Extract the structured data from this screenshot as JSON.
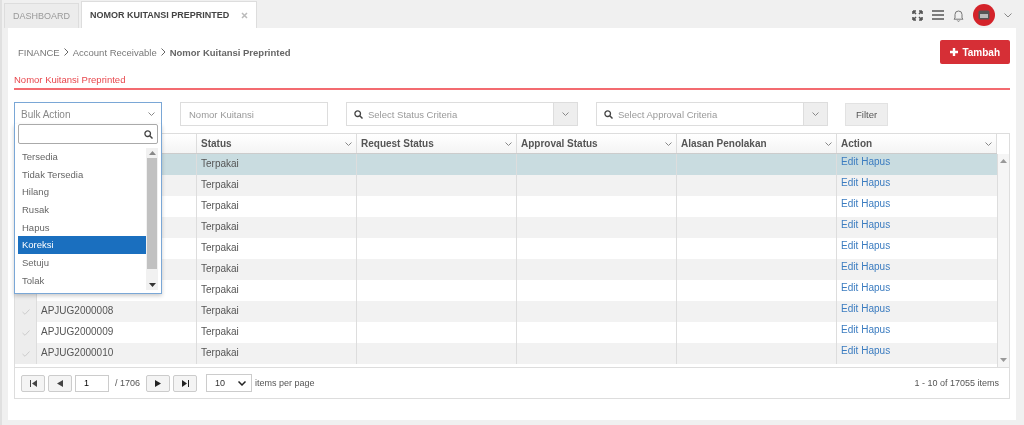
{
  "tabs": [
    {
      "label": "DASHBOARD",
      "selected": false,
      "closable": false
    },
    {
      "label": "NOMOR KUITANSI PREPRINTED",
      "selected": true,
      "closable": true
    }
  ],
  "breadcrumb": [
    "FINANCE",
    "Account Receivable",
    "Nomor Kuitansi Preprinted"
  ],
  "add_button": "Tambah",
  "section_title": "Nomor Kuitansi Preprinted",
  "filters": {
    "bulk_action": {
      "value": "Bulk Action",
      "expanded": true,
      "options": [
        {
          "label": "Tersedia",
          "selected": false
        },
        {
          "label": "Tidak Tersedia",
          "selected": false
        },
        {
          "label": "Hilang",
          "selected": false
        },
        {
          "label": "Rusak",
          "selected": false
        },
        {
          "label": "Hapus",
          "selected": false
        },
        {
          "label": "Koreksi",
          "selected": true
        },
        {
          "label": "Setuju",
          "selected": false
        },
        {
          "label": "Tolak",
          "selected": false
        }
      ]
    },
    "nomor_kuitansi": {
      "placeholder": "Nomor Kuitansi"
    },
    "status_criteria": {
      "placeholder": "Select Status Criteria"
    },
    "approval_criteria": {
      "placeholder": "Select Approval Criteria"
    },
    "filter_button": "Filter"
  },
  "table": {
    "columns": [
      "Status",
      "Request Status",
      "Approval Status",
      "Alasan Penolakan",
      "Action"
    ],
    "rows": [
      {
        "selected": true,
        "status": "Terpakai",
        "actions": [
          "Edit",
          "Hapus"
        ]
      },
      {
        "selected": false,
        "status": "Terpakai",
        "actions": [
          "Edit",
          "Hapus"
        ]
      },
      {
        "selected": false,
        "status": "Terpakai",
        "actions": [
          "Edit",
          "Hapus"
        ]
      },
      {
        "selected": false,
        "status": "Terpakai",
        "actions": [
          "Edit",
          "Hapus"
        ]
      },
      {
        "selected": false,
        "status": "Terpakai",
        "actions": [
          "Edit",
          "Hapus"
        ]
      },
      {
        "selected": false,
        "status": "Terpakai",
        "actions": [
          "Edit",
          "Hapus"
        ]
      },
      {
        "selected": false,
        "status": "Terpakai",
        "actions": [
          "Edit",
          "Hapus"
        ]
      },
      {
        "selected": false,
        "number": "APJUG2000008",
        "status": "Terpakai",
        "actions": [
          "Edit",
          "Hapus"
        ]
      },
      {
        "selected": false,
        "number": "APJUG2000009",
        "status": "Terpakai",
        "actions": [
          "Edit",
          "Hapus"
        ]
      },
      {
        "selected": false,
        "number": "APJUG2000010",
        "status": "Terpakai",
        "actions": [
          "Edit",
          "Hapus"
        ]
      }
    ]
  },
  "pager": {
    "page": "1",
    "total_pages": "/ 1706",
    "per_page": "10",
    "per_page_label": "items per page",
    "summary": "1 - 10 of 17055 items"
  }
}
